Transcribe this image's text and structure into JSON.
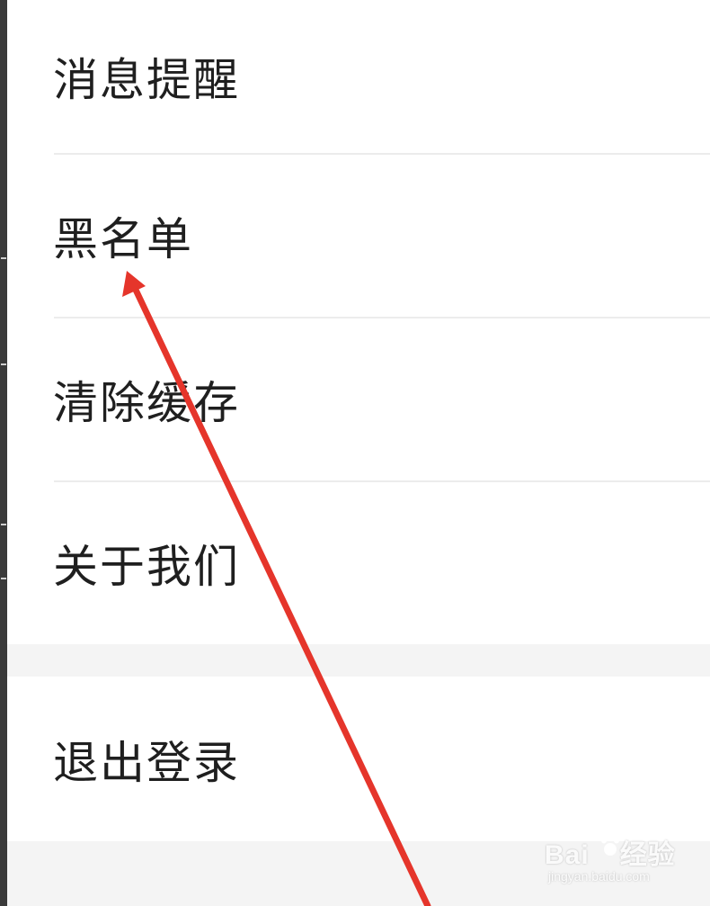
{
  "settings_menu": {
    "items": [
      {
        "label": "消息提醒"
      },
      {
        "label": "黑名单"
      },
      {
        "label": "清除缓存"
      },
      {
        "label": "关于我们"
      }
    ],
    "logout_label": "退出登录"
  },
  "annotation": {
    "arrow_color": "#e5352b",
    "points_to": "黑名单"
  },
  "watermark": {
    "brand_left": "Bai",
    "brand_right": "经验",
    "url": "jingyan.baidu.com"
  },
  "colors": {
    "background": "#f4f4f4",
    "item_background": "#ffffff",
    "divider": "#ececec",
    "text": "#1f1f1f",
    "left_edge": "#3a3a3a"
  }
}
